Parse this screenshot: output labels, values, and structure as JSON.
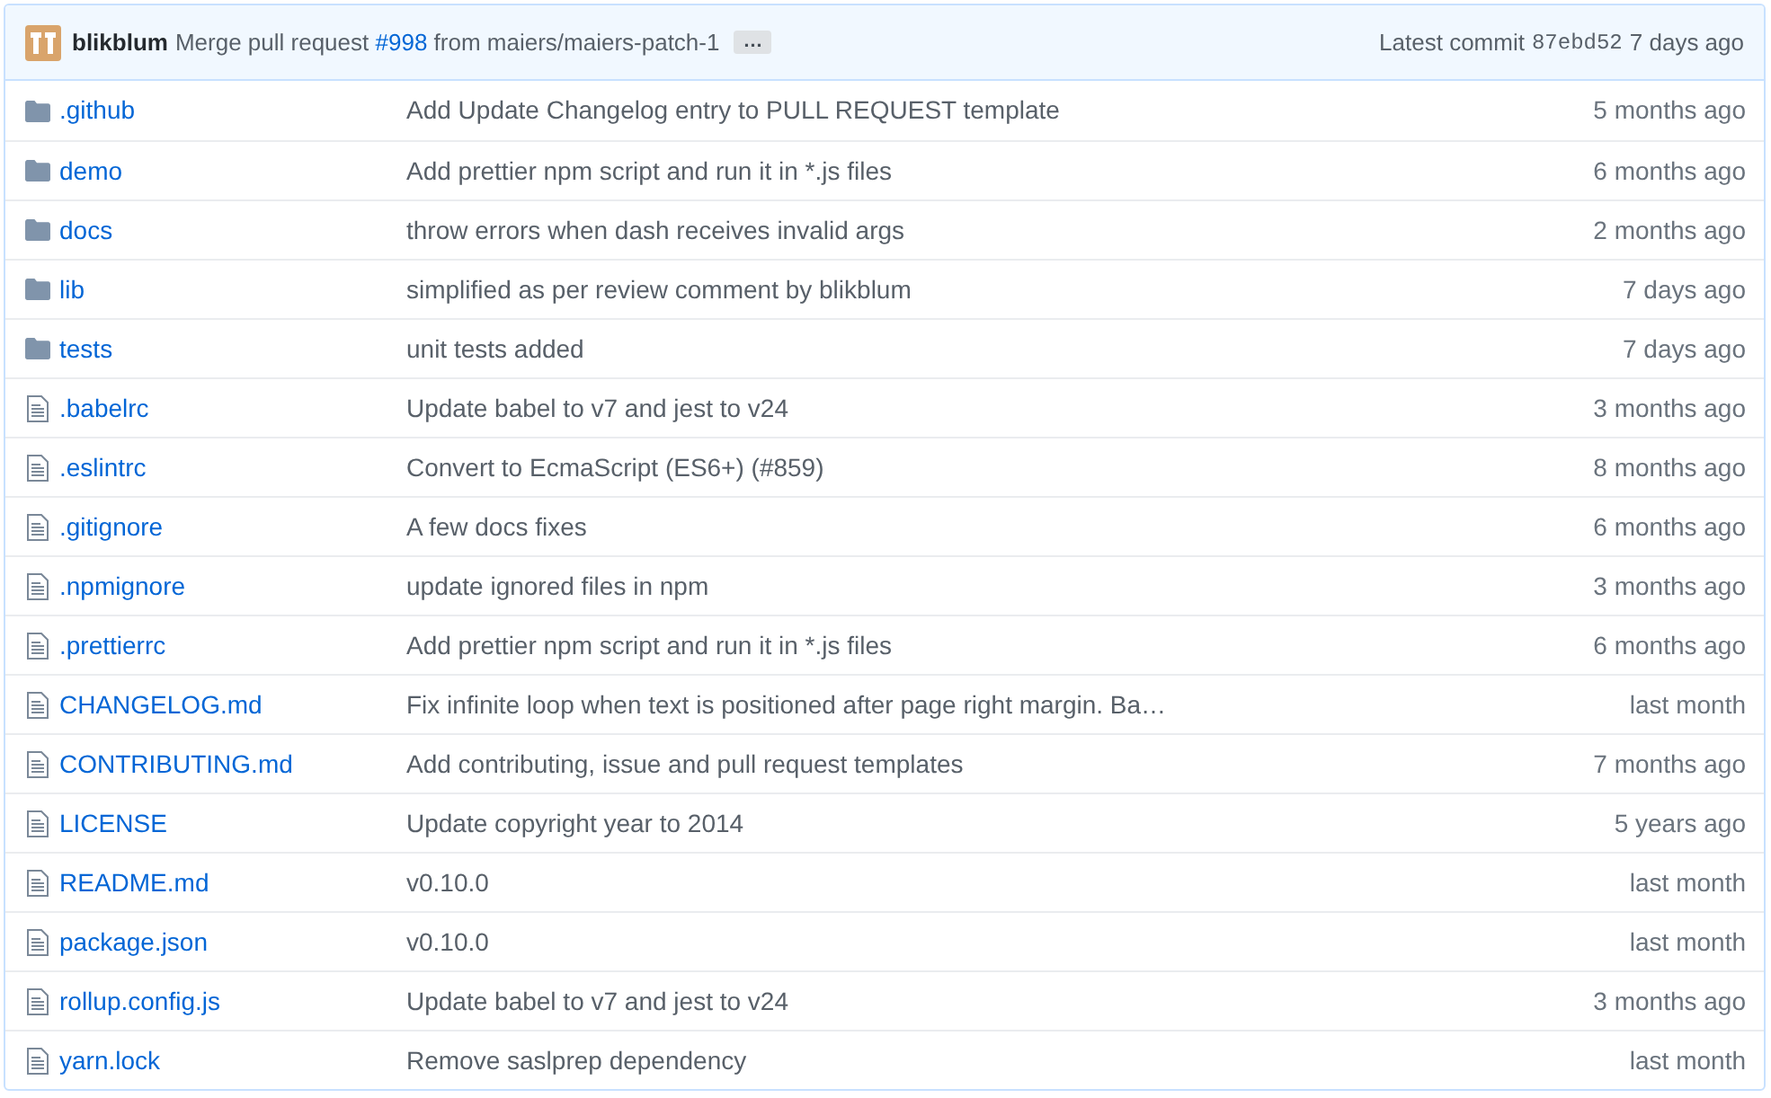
{
  "latest_commit": {
    "author": "blikblum",
    "message_before": "Merge pull request",
    "link": "#998",
    "message_after": "from maiers/maiers-patch-1",
    "ellipsis": "…",
    "label": "Latest commit",
    "sha": "87ebd52",
    "age": "7 days ago"
  },
  "files": [
    {
      "kind": "folder",
      "name": ".github",
      "message": "Add Update Changelog entry to PULL REQUEST template",
      "age": "5 months ago"
    },
    {
      "kind": "folder",
      "name": "demo",
      "message": "Add prettier npm script and run it in *.js files",
      "age": "6 months ago"
    },
    {
      "kind": "folder",
      "name": "docs",
      "message": "throw errors when dash receives invalid args",
      "age": "2 months ago"
    },
    {
      "kind": "folder",
      "name": "lib",
      "message": "simplified as per review comment by blikblum",
      "age": "7 days ago"
    },
    {
      "kind": "folder",
      "name": "tests",
      "message": "unit tests added",
      "age": "7 days ago"
    },
    {
      "kind": "file",
      "name": ".babelrc",
      "message": "Update babel to v7 and jest to v24",
      "age": "3 months ago"
    },
    {
      "kind": "file",
      "name": ".eslintrc",
      "message": "Convert to EcmaScript (ES6+) (#859)",
      "age": "8 months ago"
    },
    {
      "kind": "file",
      "name": ".gitignore",
      "message": "A few docs fixes",
      "age": "6 months ago"
    },
    {
      "kind": "file",
      "name": ".npmignore",
      "message": "update ignored files in npm",
      "age": "3 months ago"
    },
    {
      "kind": "file",
      "name": ".prettierrc",
      "message": "Add prettier npm script and run it in *.js files",
      "age": "6 months ago"
    },
    {
      "kind": "file",
      "name": "CHANGELOG.md",
      "message": "Fix infinite loop when text is positioned after page right margin. Ba…",
      "age": "last month"
    },
    {
      "kind": "file",
      "name": "CONTRIBUTING.md",
      "message": "Add contributing, issue and pull request templates",
      "age": "7 months ago"
    },
    {
      "kind": "file",
      "name": "LICENSE",
      "message": "Update copyright year to 2014",
      "age": "5 years ago"
    },
    {
      "kind": "file",
      "name": "README.md",
      "message": "v0.10.0",
      "age": "last month"
    },
    {
      "kind": "file",
      "name": "package.json",
      "message": "v0.10.0",
      "age": "last month"
    },
    {
      "kind": "file",
      "name": "rollup.config.js",
      "message": "Update babel to v7 and jest to v24",
      "age": "3 months ago"
    },
    {
      "kind": "file",
      "name": "yarn.lock",
      "message": "Remove saslprep dependency",
      "age": "last month"
    }
  ]
}
